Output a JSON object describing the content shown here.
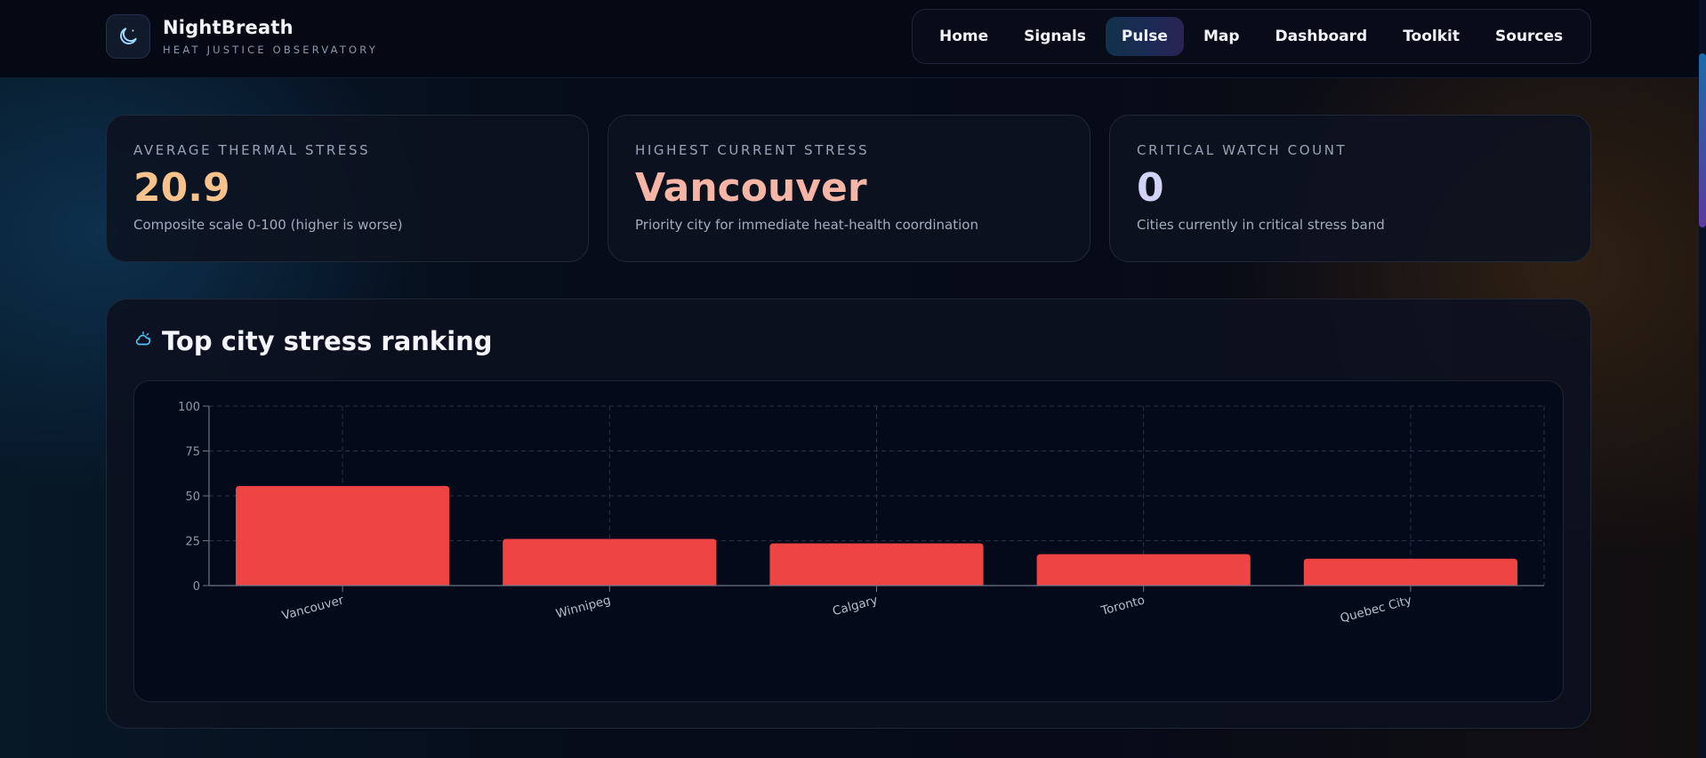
{
  "brand": {
    "title": "NightBreath",
    "subtitle": "HEAT JUSTICE OBSERVATORY",
    "icon": "moon-icon"
  },
  "nav": {
    "items": [
      {
        "label": "Home",
        "active": false
      },
      {
        "label": "Signals",
        "active": false
      },
      {
        "label": "Pulse",
        "active": true
      },
      {
        "label": "Map",
        "active": false
      },
      {
        "label": "Dashboard",
        "active": false
      },
      {
        "label": "Toolkit",
        "active": false
      },
      {
        "label": "Sources",
        "active": false
      }
    ]
  },
  "stats": [
    {
      "label": "AVERAGE THERMAL STRESS",
      "value": "20.9",
      "description": "Composite scale 0-100 (higher is worse)",
      "color": "#f7c28c"
    },
    {
      "label": "HIGHEST CURRENT STRESS",
      "value": "Vancouver",
      "description": "Priority city for immediate heat-health coordination",
      "color": "#f7b5a6"
    },
    {
      "label": "CRITICAL WATCH COUNT",
      "value": "0",
      "description": "Cities currently in critical stress band",
      "color": "#d2d3f7"
    }
  ],
  "panel": {
    "title": "Top city stress ranking",
    "icon": "cloud-sun-icon"
  },
  "colors": {
    "bar": "#ef4444",
    "accent": "#4fc3f7",
    "background": "#050a1a"
  },
  "chart_data": {
    "type": "bar",
    "categories": [
      "Vancouver",
      "Winnipeg",
      "Calgary",
      "Toronto",
      "Quebec City"
    ],
    "values": [
      55.5,
      26,
      23.5,
      17.5,
      15
    ],
    "title": "Top city stress ranking",
    "xlabel": "",
    "ylabel": "",
    "ylim": [
      0,
      100
    ],
    "yticks": [
      0,
      25,
      50,
      75,
      100
    ],
    "grid": true,
    "legend": "none"
  }
}
